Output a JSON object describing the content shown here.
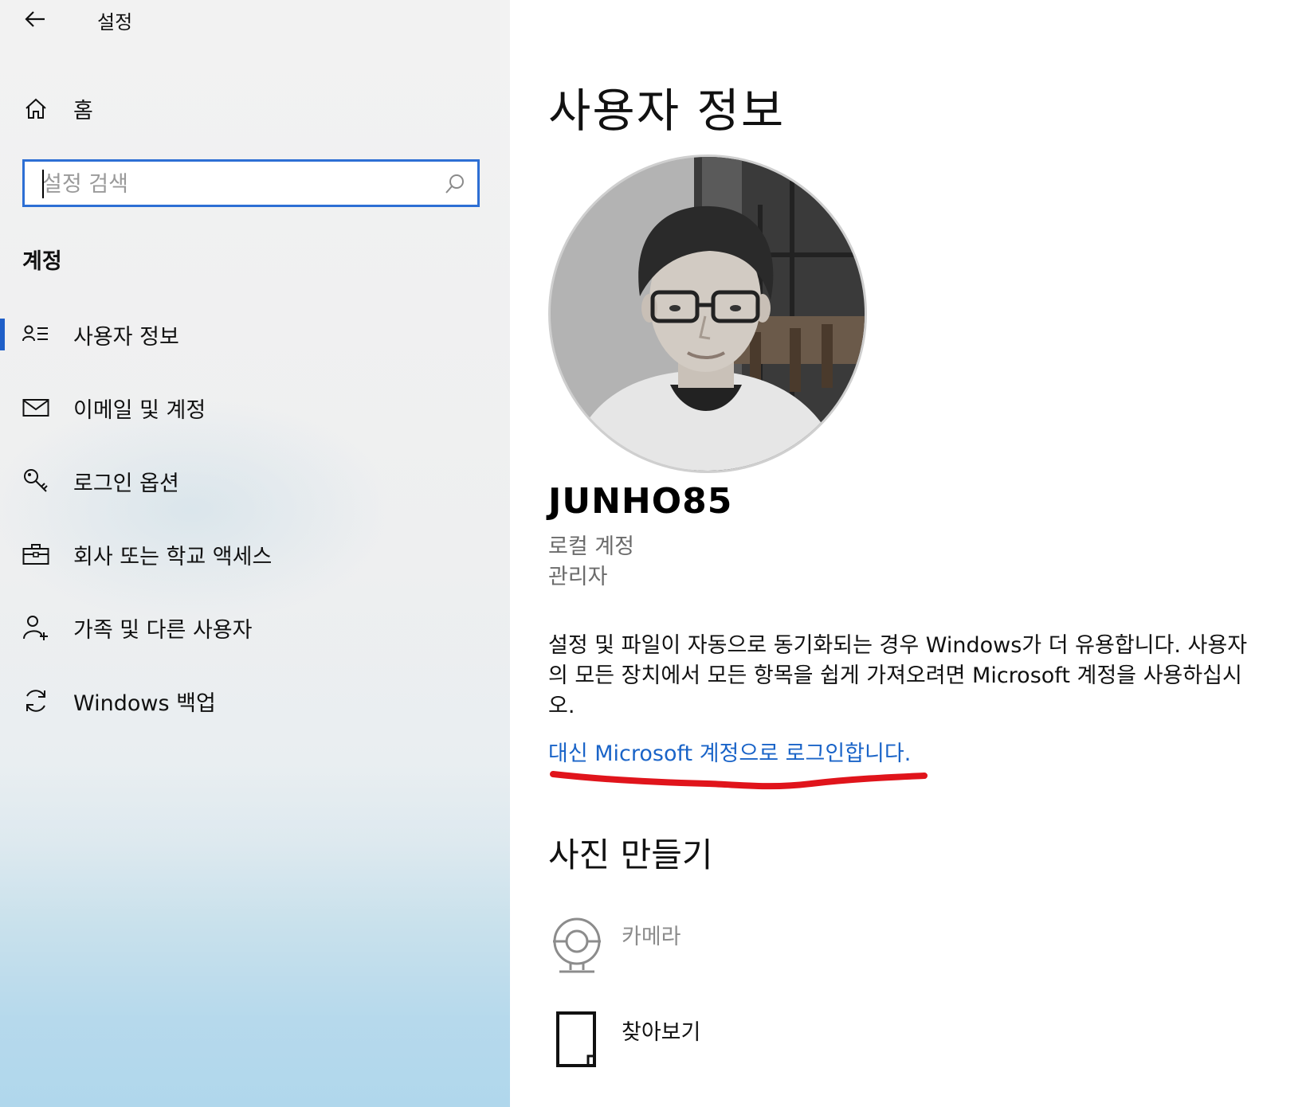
{
  "window": {
    "title": "설정"
  },
  "sidebar": {
    "home_label": "홈",
    "search": {
      "placeholder": "설정 검색",
      "value": ""
    },
    "section_heading": "계정",
    "items": [
      {
        "label": "사용자 정보",
        "icon": "person-list-icon",
        "active": true
      },
      {
        "label": "이메일 및 계정",
        "icon": "mail-icon",
        "active": false
      },
      {
        "label": "로그인 옵션",
        "icon": "key-icon",
        "active": false
      },
      {
        "label": "회사 또는 학교 액세스",
        "icon": "briefcase-icon",
        "active": false
      },
      {
        "label": "가족 및 다른 사용자",
        "icon": "person-add-icon",
        "active": false
      },
      {
        "label": "Windows 백업",
        "icon": "sync-icon",
        "active": false
      }
    ]
  },
  "main": {
    "title": "사용자 정보",
    "user": {
      "name": "JUNHO85",
      "account_type": "로컬 계정",
      "role": "관리자"
    },
    "description": "설정 및 파일이 자동으로 동기화되는 경우 Windows가 더 유용합니다. 사용자의 모든 장치에서 모든 항목을 쉽게 가져오려면 Microsoft 계정을 사용하십시오.",
    "ms_link": "대신 Microsoft 계정으로 로그인합니다.",
    "create_photo": {
      "title": "사진 만들기",
      "options": [
        {
          "label": "카메라",
          "icon": "webcam-icon",
          "enabled": false
        },
        {
          "label": "찾아보기",
          "icon": "file-icon",
          "enabled": true
        }
      ]
    }
  },
  "colors": {
    "accent": "#1f5fc8",
    "link": "#1a64c8",
    "annotation": "#e0141b"
  }
}
